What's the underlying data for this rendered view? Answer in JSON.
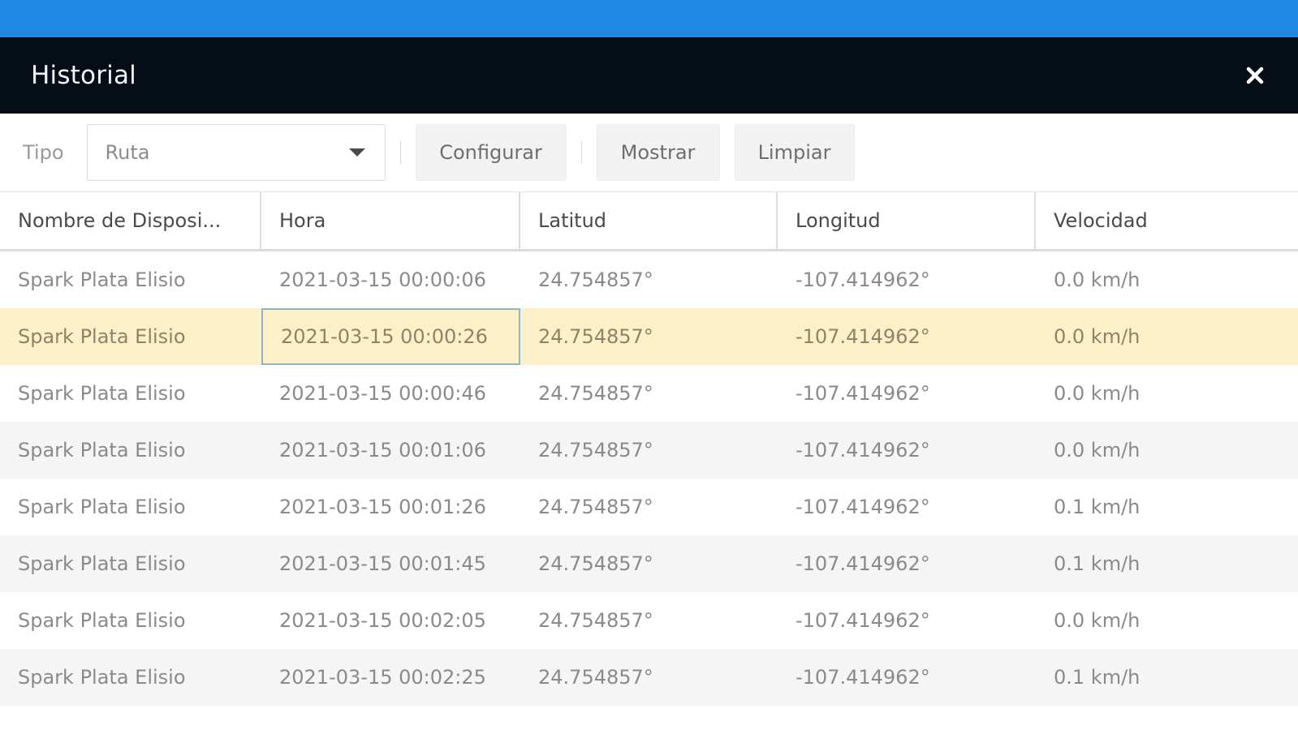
{
  "window": {
    "title": "Historial",
    "accent_color": "#1f88e5",
    "title_bar_color": "#050d17",
    "close_icon": "close-icon"
  },
  "toolbar": {
    "tipo_label": "Tipo",
    "tipo_value": "Ruta",
    "configurar_label": "Configurar",
    "mostrar_label": "Mostrar",
    "limpiar_label": "Limpiar"
  },
  "table": {
    "columns": [
      "Nombre de Disposi...",
      "Hora",
      "Latitud",
      "Longitud",
      "Velocidad"
    ],
    "selected_row_index": 1,
    "selected_row_color": "#fdf0c8",
    "rows": [
      [
        "Spark Plata Elisio",
        "2021-03-15 00:00:06",
        "24.754857°",
        "-107.414962°",
        "0.0 km/h"
      ],
      [
        "Spark Plata Elisio",
        "2021-03-15 00:00:26",
        "24.754857°",
        "-107.414962°",
        "0.0 km/h"
      ],
      [
        "Spark Plata Elisio",
        "2021-03-15 00:00:46",
        "24.754857°",
        "-107.414962°",
        "0.0 km/h"
      ],
      [
        "Spark Plata Elisio",
        "2021-03-15 00:01:06",
        "24.754857°",
        "-107.414962°",
        "0.0 km/h"
      ],
      [
        "Spark Plata Elisio",
        "2021-03-15 00:01:26",
        "24.754857°",
        "-107.414962°",
        "0.1 km/h"
      ],
      [
        "Spark Plata Elisio",
        "2021-03-15 00:01:45",
        "24.754857°",
        "-107.414962°",
        "0.1 km/h"
      ],
      [
        "Spark Plata Elisio",
        "2021-03-15 00:02:05",
        "24.754857°",
        "-107.414962°",
        "0.0 km/h"
      ],
      [
        "Spark Plata Elisio",
        "2021-03-15 00:02:25",
        "24.754857°",
        "-107.414962°",
        "0.1 km/h"
      ]
    ]
  }
}
